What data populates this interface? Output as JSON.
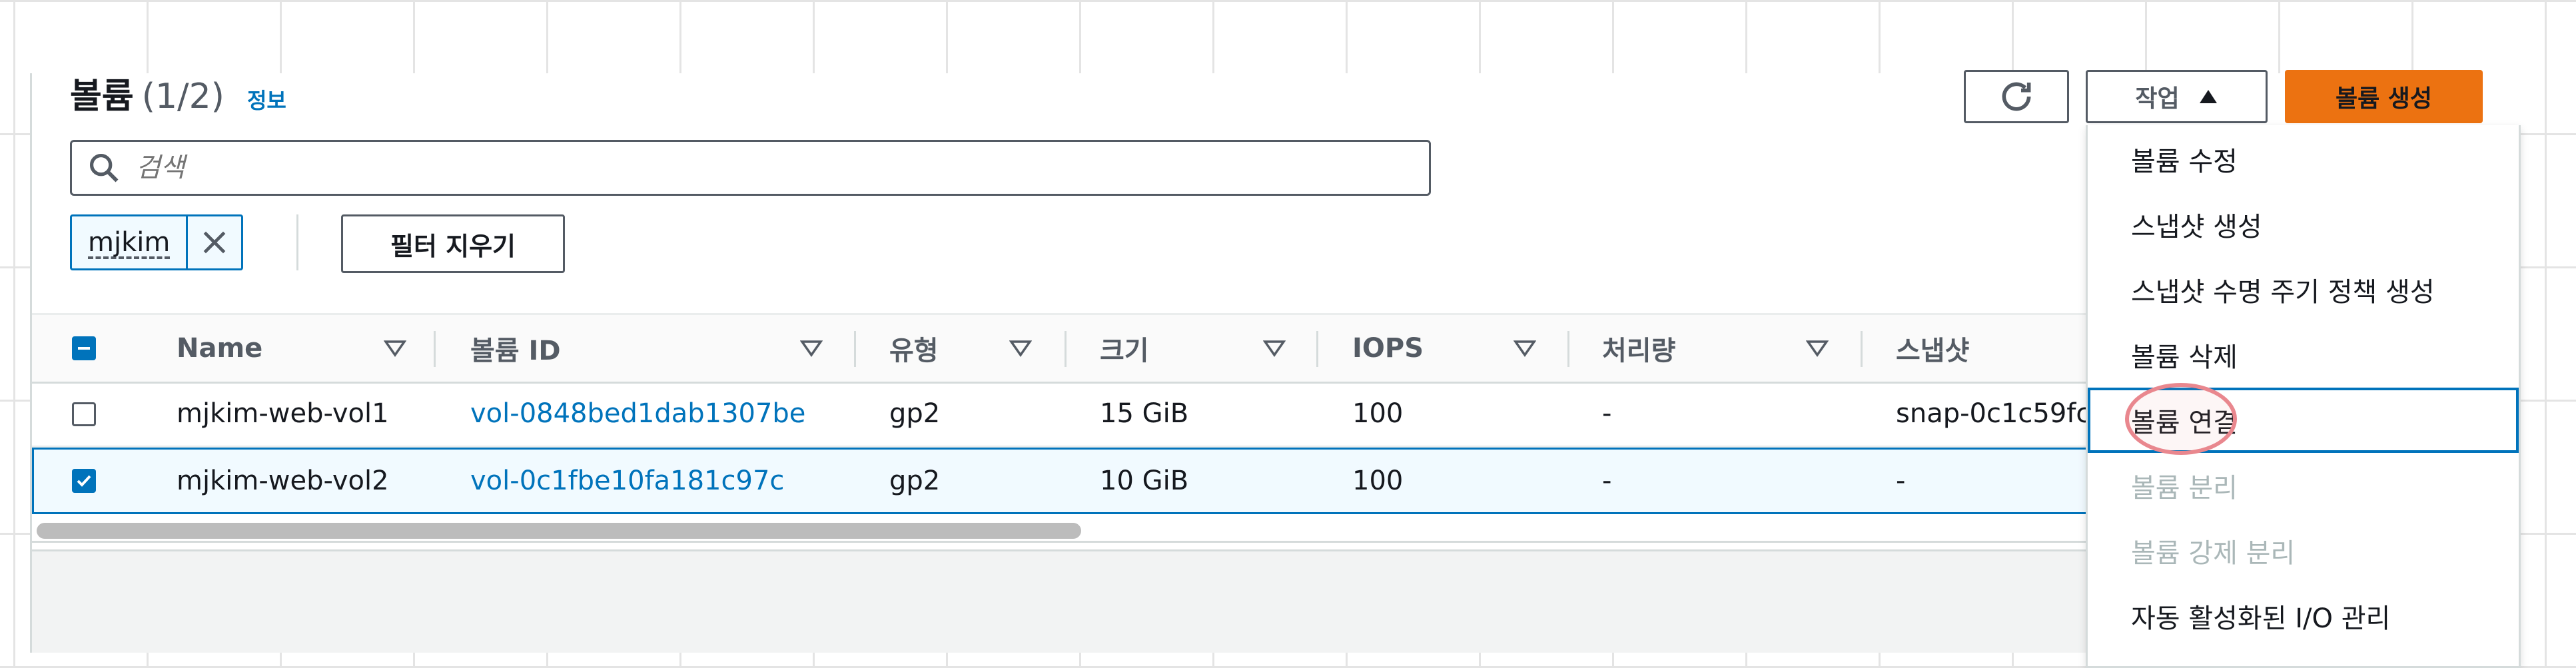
{
  "header": {
    "title": "볼륨",
    "count": "(1/2)",
    "info_link": "정보",
    "actions_label": "작업",
    "create_label": "볼륨 생성"
  },
  "search": {
    "placeholder": "검색"
  },
  "filter": {
    "token": "mjkim",
    "clear_label": "필터 지우기"
  },
  "table": {
    "columns": [
      "Name",
      "볼륨 ID",
      "유형",
      "크기",
      "IOPS",
      "처리량",
      "스냅샷"
    ],
    "rows": [
      {
        "selected": false,
        "name": "mjkim-web-vol1",
        "volume_id": "vol-0848bed1dab1307be",
        "type": "gp2",
        "size": "15 GiB",
        "iops": "100",
        "throughput": "-",
        "snapshot": "snap-0c1c59fc"
      },
      {
        "selected": true,
        "name": "mjkim-web-vol2",
        "volume_id": "vol-0c1fbe10fa181c97c",
        "type": "gp2",
        "size": "10 GiB",
        "iops": "100",
        "throughput": "-",
        "snapshot": "-"
      }
    ]
  },
  "actions_menu": {
    "items": [
      {
        "label": "볼륨 수정",
        "disabled": false
      },
      {
        "label": "스냅샷 생성",
        "disabled": false
      },
      {
        "label": "스냅샷 수명 주기 정책 생성",
        "disabled": false
      },
      {
        "label": "볼륨 삭제",
        "disabled": false
      },
      {
        "label": "볼륨 연결",
        "disabled": false,
        "focused": true
      },
      {
        "label": "볼륨 분리",
        "disabled": true
      },
      {
        "label": "볼륨 강제 분리",
        "disabled": true
      },
      {
        "label": "자동 활성화된 I/O 관리",
        "disabled": false
      }
    ]
  },
  "colors": {
    "accent": "#0073bb",
    "primary_button": "#ec7211",
    "highlight": "#e9878e"
  }
}
